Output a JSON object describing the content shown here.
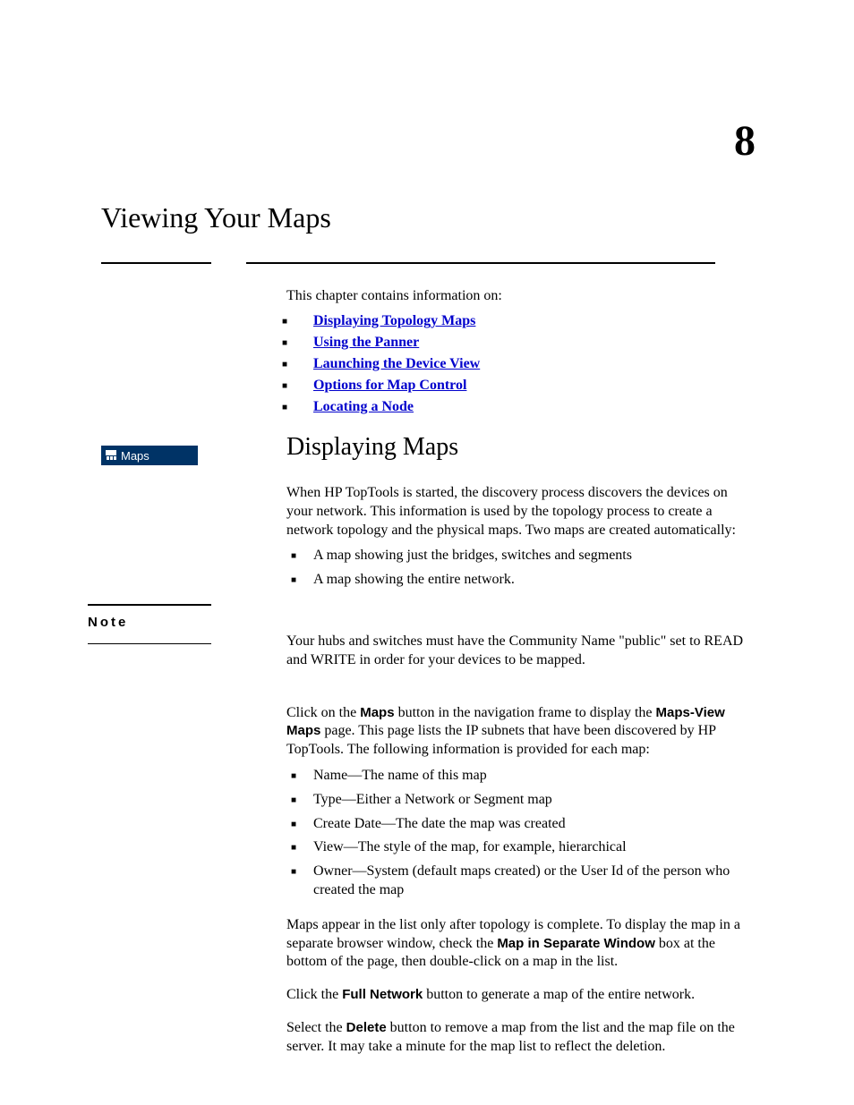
{
  "chapter": {
    "number": "8",
    "title": "Viewing Your Maps"
  },
  "intro": "This chapter contains information on:",
  "toc": [
    "Displaying Topology Maps",
    "Using the Panner",
    "Launching the Device View",
    "Options for Map Control",
    "Locating a Node"
  ],
  "section_heading": "Displaying Maps",
  "maps_button": "Maps",
  "para1": "When HP TopTools is started, the discovery process discovers the devices on your network. This information is used by the topology process to create a network topology and the physical maps. Two maps are created automatically:",
  "list1": [
    "A map showing just the bridges, switches and segments",
    "A map showing the entire network."
  ],
  "note_label": "Note",
  "note_text": "Your hubs and switches must have the Community Name \"public\" set to READ and WRITE in order for your devices to be mapped.",
  "para2_pre": "Click on the ",
  "para2_bold1": "Maps",
  "para2_mid1": " button in the navigation frame to display the ",
  "para2_bold2": "Maps-View Maps",
  "para2_mid2": " page. This page lists the IP subnets that have been discovered by HP TopTools. The following information is provided for each map:",
  "list2": [
    "Name—The name of this map",
    "Type—Either a Network or Segment map",
    "Create Date—The date the map was created",
    "View—The style of the map, for example, hierarchical",
    "Owner—System (default maps created) or the User Id of the person who created the map"
  ],
  "para3_pre": "Maps appear in the list only after topology is complete. To display the map in a separate browser window, check the ",
  "para3_bold": "Map in Separate Window",
  "para3_post": " box at the bottom of the page, then double-click on a map in the list.",
  "para4_pre": "Click the ",
  "para4_bold": "Full Network",
  "para4_post": " button to generate a map of the entire network.",
  "para5_pre": "Select the ",
  "para5_bold": "Delete",
  "para5_post": " button to remove a map from the list and the map file on the server. It may take a minute for the map list to reflect the deletion."
}
